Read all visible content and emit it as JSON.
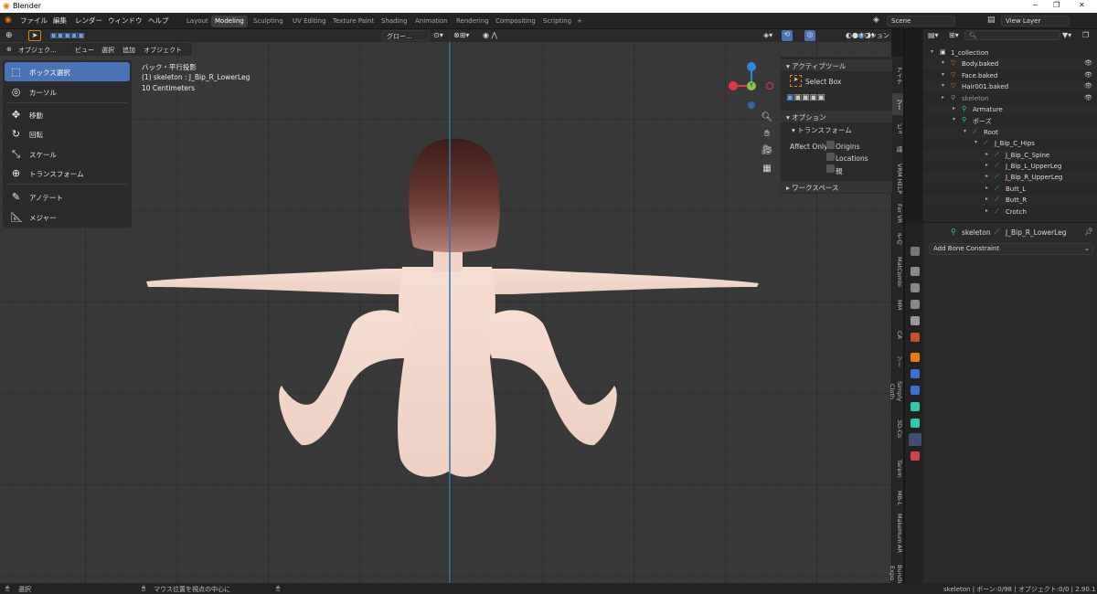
{
  "window": {
    "title": "Blender",
    "min": "─",
    "max": "❐",
    "close": "✕"
  },
  "menu": [
    "ファイル",
    "編集",
    "レンダー",
    "ウィンドウ",
    "ヘルプ"
  ],
  "workspaces": {
    "tabs": [
      "Layout",
      "Modeling",
      "Sculpting",
      "UV Editing",
      "Texture Paint",
      "Shading",
      "Animation",
      "Rendering",
      "Compositing",
      "Scripting"
    ],
    "active": "Modeling",
    "add": "+"
  },
  "scene": {
    "name": "Scene",
    "view_layer": "View Layer"
  },
  "viewport_header": {
    "mode": "オブジェク...",
    "menus": [
      "ビュー",
      "選択",
      "追加",
      "オブジェクト"
    ],
    "orientation": "グロー...",
    "options": "オプション"
  },
  "tools": [
    {
      "label": "ボックス選択",
      "icon": "select-box-icon",
      "active": true
    },
    {
      "label": "カーソル",
      "icon": "cursor-icon",
      "active": false
    },
    {
      "label": "移動",
      "icon": "move-icon",
      "active": false
    },
    {
      "label": "回転",
      "icon": "rotate-icon",
      "active": false
    },
    {
      "label": "スケール",
      "icon": "scale-icon",
      "active": false
    },
    {
      "label": "トランスフォーム",
      "icon": "transform-icon",
      "active": false
    },
    {
      "label": "アノテート",
      "icon": "annotate-icon",
      "active": false
    },
    {
      "label": "メジャー",
      "icon": "measure-icon",
      "active": false
    }
  ],
  "viewport_info": {
    "line1": "バック・平行投影",
    "line2": "(1) skeleton : J_Bip_R_LowerLeg",
    "line3": "10 Centimeters"
  },
  "gizmo": {
    "z": "Z",
    "y": "Y",
    "x": "X"
  },
  "npanel": {
    "active_tool_header": "アクティブツール",
    "select_box": "Select Box",
    "options_header": "オプション",
    "transform_header": "トランスフォーム",
    "affect_only": "Affect Only",
    "origins": "Origins",
    "locations": "Locations",
    "parents": "親",
    "workspace_header": "ワークスペース"
  },
  "side_tabs": [
    "アイテ",
    "ツー",
    "ビュ",
    "議",
    "VRM HELP",
    "For VR",
    "その",
    "MatCombi",
    "MM",
    "CA",
    "ツー",
    "Simply Cloth",
    "3D-Co",
    "Tarem",
    "MB-L",
    "MakeHum",
    "AR",
    "Bundle Expo"
  ],
  "side_tabs_active": "ツー",
  "outliner": {
    "search_placeholder": "",
    "rows": [
      {
        "label": "1_collection",
        "indent": 0
      },
      {
        "label": "Body.baked",
        "indent": 1
      },
      {
        "label": "Face.baked",
        "indent": 1
      },
      {
        "label": "Hair001.baked",
        "indent": 1
      },
      {
        "label": "skeleton",
        "indent": 1
      },
      {
        "label": "Armature",
        "indent": 2
      },
      {
        "label": "ポーズ",
        "indent": 2
      },
      {
        "label": "Root",
        "indent": 3
      },
      {
        "label": "J_Bip_C_Hips",
        "indent": 4
      },
      {
        "label": "J_Bip_C_Spine",
        "indent": 5
      },
      {
        "label": "J_Bip_L_UpperLeg",
        "indent": 5
      },
      {
        "label": "J_Bip_R_UpperLeg",
        "indent": 5
      },
      {
        "label": "Butt_L",
        "indent": 5
      },
      {
        "label": "Butt_R",
        "indent": 5
      },
      {
        "label": "Crotch",
        "indent": 5
      }
    ]
  },
  "properties": {
    "object": "skeleton",
    "bone": "J_Bip_R_LowerLeg",
    "add_constraint": "Add Bone Constraint"
  },
  "status": {
    "select": "選択",
    "center": "マウス位置を視点の中心に",
    "info": "skeleton | ボーン:0/98 | オブジェクト:0/0 | 2.90.1"
  },
  "colors": {
    "accent": "#4a73b4",
    "axis_x": "#e0354b",
    "axis_y": "#8bc34a",
    "axis_z": "#2e86de",
    "bone": "#35c8a8"
  }
}
